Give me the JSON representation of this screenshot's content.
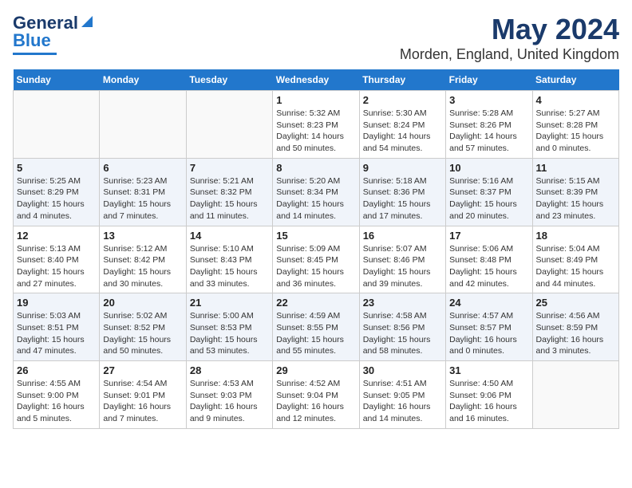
{
  "header": {
    "logo_general": "General",
    "logo_blue": "Blue",
    "month": "May 2024",
    "location": "Morden, England, United Kingdom"
  },
  "days_of_week": [
    "Sunday",
    "Monday",
    "Tuesday",
    "Wednesday",
    "Thursday",
    "Friday",
    "Saturday"
  ],
  "weeks": [
    [
      {
        "day": "",
        "info": ""
      },
      {
        "day": "",
        "info": ""
      },
      {
        "day": "",
        "info": ""
      },
      {
        "day": "1",
        "info": "Sunrise: 5:32 AM\nSunset: 8:23 PM\nDaylight: 14 hours\nand 50 minutes."
      },
      {
        "day": "2",
        "info": "Sunrise: 5:30 AM\nSunset: 8:24 PM\nDaylight: 14 hours\nand 54 minutes."
      },
      {
        "day": "3",
        "info": "Sunrise: 5:28 AM\nSunset: 8:26 PM\nDaylight: 14 hours\nand 57 minutes."
      },
      {
        "day": "4",
        "info": "Sunrise: 5:27 AM\nSunset: 8:28 PM\nDaylight: 15 hours\nand 0 minutes."
      }
    ],
    [
      {
        "day": "5",
        "info": "Sunrise: 5:25 AM\nSunset: 8:29 PM\nDaylight: 15 hours\nand 4 minutes."
      },
      {
        "day": "6",
        "info": "Sunrise: 5:23 AM\nSunset: 8:31 PM\nDaylight: 15 hours\nand 7 minutes."
      },
      {
        "day": "7",
        "info": "Sunrise: 5:21 AM\nSunset: 8:32 PM\nDaylight: 15 hours\nand 11 minutes."
      },
      {
        "day": "8",
        "info": "Sunrise: 5:20 AM\nSunset: 8:34 PM\nDaylight: 15 hours\nand 14 minutes."
      },
      {
        "day": "9",
        "info": "Sunrise: 5:18 AM\nSunset: 8:36 PM\nDaylight: 15 hours\nand 17 minutes."
      },
      {
        "day": "10",
        "info": "Sunrise: 5:16 AM\nSunset: 8:37 PM\nDaylight: 15 hours\nand 20 minutes."
      },
      {
        "day": "11",
        "info": "Sunrise: 5:15 AM\nSunset: 8:39 PM\nDaylight: 15 hours\nand 23 minutes."
      }
    ],
    [
      {
        "day": "12",
        "info": "Sunrise: 5:13 AM\nSunset: 8:40 PM\nDaylight: 15 hours\nand 27 minutes."
      },
      {
        "day": "13",
        "info": "Sunrise: 5:12 AM\nSunset: 8:42 PM\nDaylight: 15 hours\nand 30 minutes."
      },
      {
        "day": "14",
        "info": "Sunrise: 5:10 AM\nSunset: 8:43 PM\nDaylight: 15 hours\nand 33 minutes."
      },
      {
        "day": "15",
        "info": "Sunrise: 5:09 AM\nSunset: 8:45 PM\nDaylight: 15 hours\nand 36 minutes."
      },
      {
        "day": "16",
        "info": "Sunrise: 5:07 AM\nSunset: 8:46 PM\nDaylight: 15 hours\nand 39 minutes."
      },
      {
        "day": "17",
        "info": "Sunrise: 5:06 AM\nSunset: 8:48 PM\nDaylight: 15 hours\nand 42 minutes."
      },
      {
        "day": "18",
        "info": "Sunrise: 5:04 AM\nSunset: 8:49 PM\nDaylight: 15 hours\nand 44 minutes."
      }
    ],
    [
      {
        "day": "19",
        "info": "Sunrise: 5:03 AM\nSunset: 8:51 PM\nDaylight: 15 hours\nand 47 minutes."
      },
      {
        "day": "20",
        "info": "Sunrise: 5:02 AM\nSunset: 8:52 PM\nDaylight: 15 hours\nand 50 minutes."
      },
      {
        "day": "21",
        "info": "Sunrise: 5:00 AM\nSunset: 8:53 PM\nDaylight: 15 hours\nand 53 minutes."
      },
      {
        "day": "22",
        "info": "Sunrise: 4:59 AM\nSunset: 8:55 PM\nDaylight: 15 hours\nand 55 minutes."
      },
      {
        "day": "23",
        "info": "Sunrise: 4:58 AM\nSunset: 8:56 PM\nDaylight: 15 hours\nand 58 minutes."
      },
      {
        "day": "24",
        "info": "Sunrise: 4:57 AM\nSunset: 8:57 PM\nDaylight: 16 hours\nand 0 minutes."
      },
      {
        "day": "25",
        "info": "Sunrise: 4:56 AM\nSunset: 8:59 PM\nDaylight: 16 hours\nand 3 minutes."
      }
    ],
    [
      {
        "day": "26",
        "info": "Sunrise: 4:55 AM\nSunset: 9:00 PM\nDaylight: 16 hours\nand 5 minutes."
      },
      {
        "day": "27",
        "info": "Sunrise: 4:54 AM\nSunset: 9:01 PM\nDaylight: 16 hours\nand 7 minutes."
      },
      {
        "day": "28",
        "info": "Sunrise: 4:53 AM\nSunset: 9:03 PM\nDaylight: 16 hours\nand 9 minutes."
      },
      {
        "day": "29",
        "info": "Sunrise: 4:52 AM\nSunset: 9:04 PM\nDaylight: 16 hours\nand 12 minutes."
      },
      {
        "day": "30",
        "info": "Sunrise: 4:51 AM\nSunset: 9:05 PM\nDaylight: 16 hours\nand 14 minutes."
      },
      {
        "day": "31",
        "info": "Sunrise: 4:50 AM\nSunset: 9:06 PM\nDaylight: 16 hours\nand 16 minutes."
      },
      {
        "day": "",
        "info": ""
      }
    ]
  ]
}
